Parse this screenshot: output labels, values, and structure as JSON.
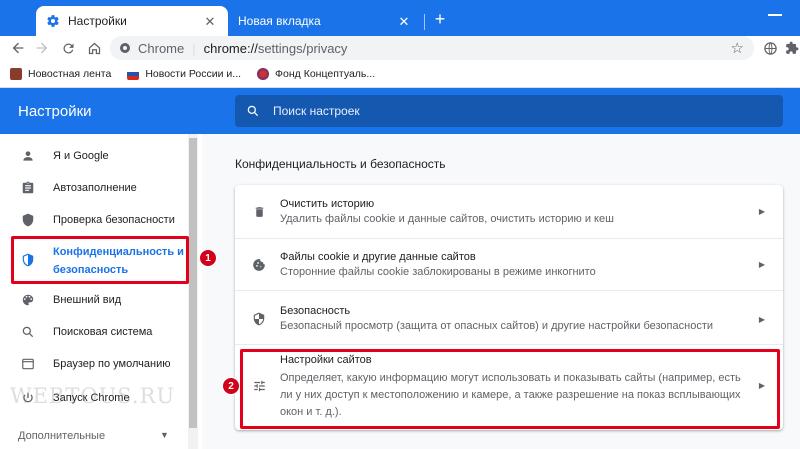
{
  "tabs": [
    {
      "title": "Настройки",
      "active": true,
      "icon": "gear-icon"
    },
    {
      "title": "Новая вкладка",
      "active": false
    }
  ],
  "toolbar": {
    "site_chip": "Chrome",
    "url_prefix": "chrome://",
    "url_path": "settings/privacy"
  },
  "bookmarks": [
    {
      "label": "Новостная лента",
      "icon_color": "#8a3b2b"
    },
    {
      "label": "Новости России и...",
      "icon_color": "#2255aa"
    },
    {
      "label": "Фонд Концептуаль...",
      "icon_color": "#6b2a6b"
    }
  ],
  "header": {
    "title": "Настройки",
    "search_placeholder": "Поиск настроек"
  },
  "sidebar": {
    "items": [
      {
        "label": "Я и Google",
        "icon": "person-icon"
      },
      {
        "label": "Автозаполнение",
        "icon": "clipboard-icon"
      },
      {
        "label": "Проверка безопасности",
        "icon": "shield-check-icon"
      },
      {
        "label": "Конфиденциальность и безопасность",
        "label_line1": "Конфиденциальность и",
        "label_line2": "безопасность",
        "icon": "shield-blue-icon",
        "selected": true
      },
      {
        "label": "Внешний вид",
        "icon": "palette-icon"
      },
      {
        "label": "Поисковая система",
        "icon": "search-icon"
      },
      {
        "label": "Браузер по умолчанию",
        "icon": "browser-icon"
      },
      {
        "label": "Запуск Chrome",
        "icon": "power-icon"
      }
    ],
    "advanced_label": "Дополнительные",
    "watermark": "WEBTOUS.RU"
  },
  "main": {
    "section_title": "Конфиденциальность и безопасность",
    "rows": [
      {
        "title": "Очистить историю",
        "subtitle": "Удалить файлы cookie и данные сайтов, очистить историю и кеш",
        "icon": "trash-icon"
      },
      {
        "title": "Файлы cookie и другие данные сайтов",
        "subtitle": "Сторонние файлы cookie заблокированы в режиме инкогнито",
        "icon": "cookie-icon"
      },
      {
        "title": "Безопасность",
        "subtitle": "Безопасный просмотр (защита от опасных сайтов) и другие настройки безопасности",
        "icon": "shield-half-icon"
      },
      {
        "title": "Настройки сайтов",
        "subtitle_line1": "Определяет, какую информацию могут использовать и показывать сайты (например, есть",
        "subtitle_line2": "ли у них доступ к местоположению и камере, а также разрешение на показ всплывающих",
        "subtitle_line3": "окон и т. д.).",
        "icon": "sliders-icon"
      }
    ]
  },
  "annotations": [
    {
      "number": "1",
      "color": "#e3001b"
    },
    {
      "number": "2",
      "color": "#e3001b"
    }
  ],
  "colors": {
    "accent": "#1a73e8",
    "annotation": "#e3001b"
  }
}
